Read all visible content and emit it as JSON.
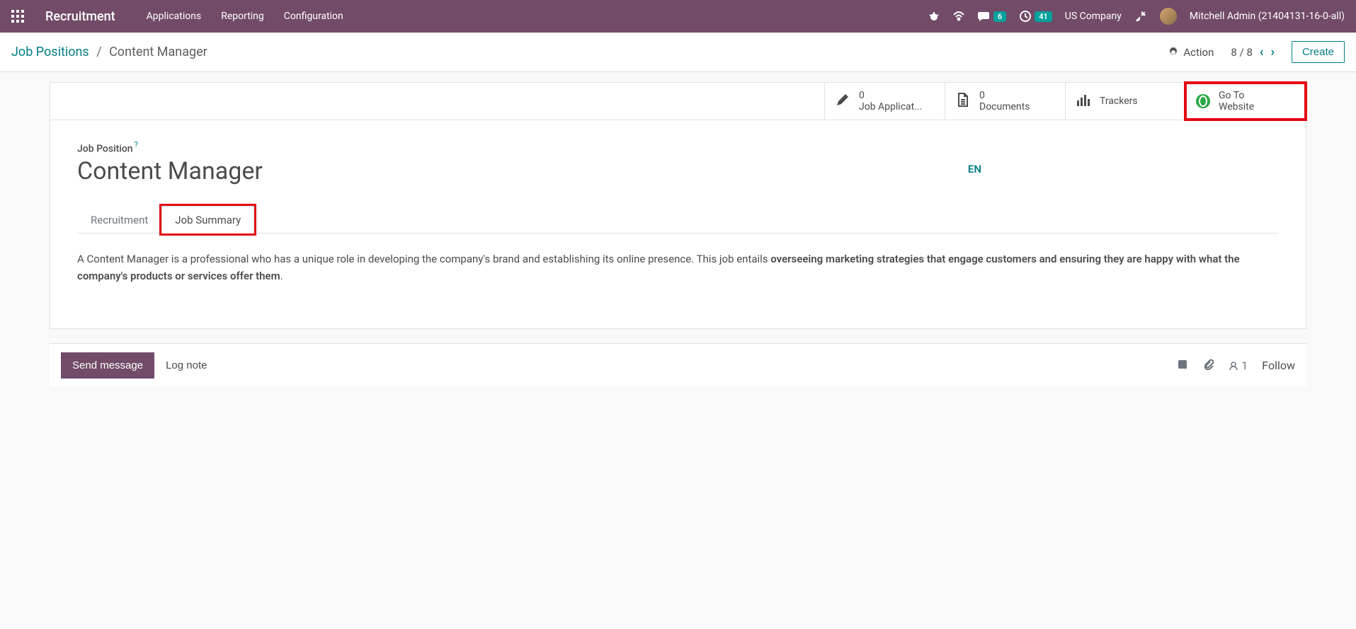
{
  "topbar": {
    "app_title": "Recruitment",
    "menu": [
      "Applications",
      "Reporting",
      "Configuration"
    ],
    "messages_badge": "6",
    "activities_badge": "41",
    "company": "US Company",
    "user": "Mitchell Admin (21404131-16-0-all)"
  },
  "subheader": {
    "breadcrumb_root": "Job Positions",
    "breadcrumb_current": "Content Manager",
    "action_label": "Action",
    "pager": "8 / 8",
    "create_label": "Create"
  },
  "stats": {
    "applications": {
      "count": "0",
      "label": "Job Applicat..."
    },
    "documents": {
      "count": "0",
      "label": "Documents"
    },
    "trackers": {
      "label": "Trackers"
    },
    "website": {
      "line1": "Go To",
      "line2": "Website"
    }
  },
  "form": {
    "field_label": "Job Position",
    "title": "Content Manager",
    "lang": "EN"
  },
  "tabs": {
    "recruitment": "Recruitment",
    "job_summary": "Job Summary"
  },
  "summary": {
    "part1": "A Content Manager is a professional who has a unique role in developing the company's brand and establishing its online presence. This job entails ",
    "part2": "overseeing marketing strategies that engage customers and ensuring they are happy with what the company's products or services offer them",
    "part3": "."
  },
  "chatter": {
    "send": "Send message",
    "log": "Log note",
    "followers": "1",
    "follow": "Follow"
  }
}
